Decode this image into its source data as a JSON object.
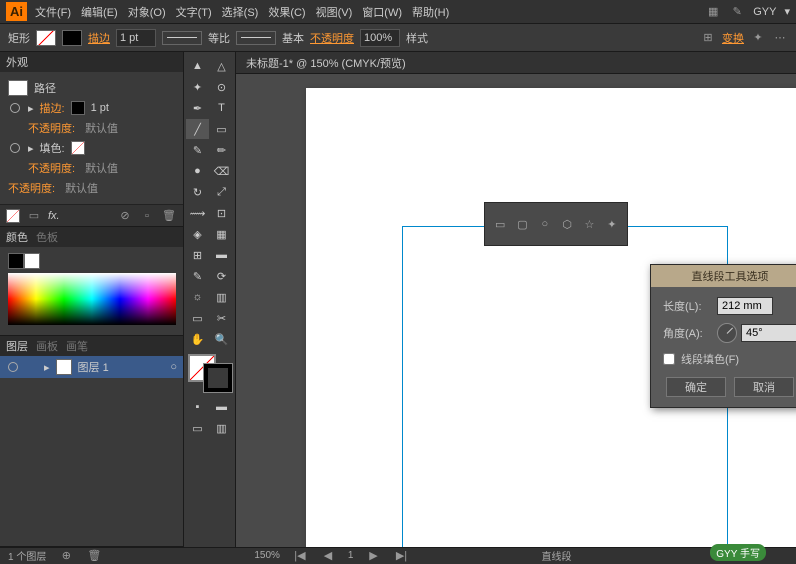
{
  "menubar": {
    "items": [
      "文件(F)",
      "编辑(E)",
      "对象(O)",
      "文字(T)",
      "选择(S)",
      "效果(C)",
      "视图(V)",
      "窗口(W)",
      "帮助(H)"
    ],
    "user": "GYY"
  },
  "controlbar": {
    "shape": "矩形",
    "stroke_label": "描边",
    "stroke_pt": "1 pt",
    "uniform": "等比",
    "basic": "基本",
    "opacity_label": "不透明度",
    "opacity": "100%",
    "style": "样式",
    "transform": "变换"
  },
  "doc_tab": "未标题-1* @ 150% (CMYK/预览)",
  "appearance": {
    "tab": "外观",
    "object": "路径",
    "stroke": "描边:",
    "stroke_val": "1 pt",
    "opacity": "不透明度:",
    "default": "默认值",
    "fill": "填色:"
  },
  "color": {
    "tab1": "颜色",
    "tab2": "色板"
  },
  "layers": {
    "tab1": "图层",
    "tab2": "画板",
    "tab3": "画笔",
    "layer1": "图层 1"
  },
  "dialog": {
    "title": "直线段工具选项",
    "length_label": "长度(L):",
    "length_val": "212 mm",
    "angle_label": "角度(A):",
    "angle_val": "45°",
    "fill_check": "线段填色(F)",
    "ok": "确定",
    "cancel": "取消"
  },
  "status": {
    "layers": "1 个图层",
    "zoom": "150%",
    "tool": "直线段",
    "badge": "GYY 手写"
  }
}
